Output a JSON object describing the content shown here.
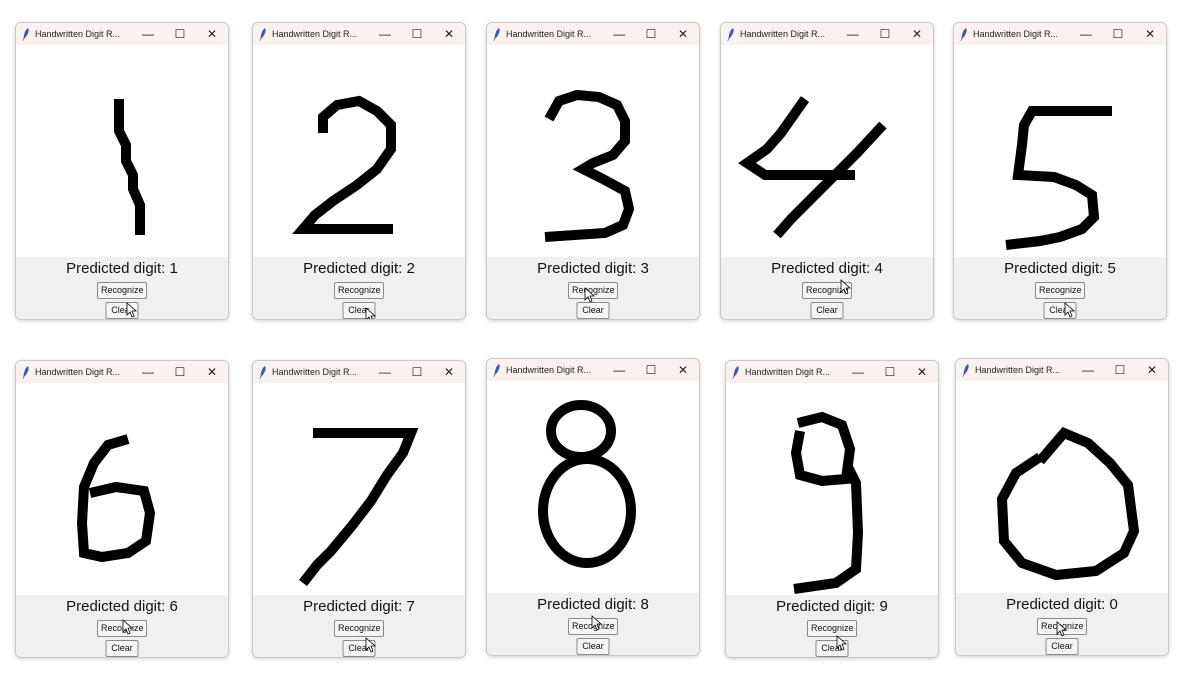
{
  "windows": [
    {
      "title": "Handwritten Digit R...",
      "prediction": "Predicted digit: 1",
      "recognize_label": "Recognize",
      "clear_label": "Clear",
      "minimize_label": "—",
      "maximize_label": "☐",
      "close_label": "✕",
      "digit": "1",
      "cursor_on": "clear"
    },
    {
      "title": "Handwritten Digit R...",
      "prediction": "Predicted digit: 2",
      "recognize_label": "Recognize",
      "clear_label": "Clear",
      "minimize_label": "—",
      "maximize_label": "☐",
      "close_label": "✕",
      "digit": "2",
      "cursor_on": "clear"
    },
    {
      "title": "Handwritten Digit R...",
      "prediction": "Predicted digit: 3",
      "recognize_label": "Recognize",
      "clear_label": "Clear",
      "minimize_label": "—",
      "maximize_label": "☐",
      "close_label": "✕",
      "digit": "3",
      "cursor_on": "recognize"
    },
    {
      "title": "Handwritten Digit R...",
      "prediction": "Predicted digit: 4",
      "recognize_label": "Recognize",
      "clear_label": "Clear",
      "minimize_label": "—",
      "maximize_label": "☐",
      "close_label": "✕",
      "digit": "4",
      "cursor_on": "recognize"
    },
    {
      "title": "Handwritten Digit R...",
      "prediction": "Predicted digit: 5",
      "recognize_label": "Recognize",
      "clear_label": "Clear",
      "minimize_label": "—",
      "maximize_label": "☐",
      "close_label": "✕",
      "digit": "5",
      "cursor_on": "clear"
    },
    {
      "title": "Handwritten Digit R...",
      "prediction": "Predicted digit: 6",
      "recognize_label": "Recognize",
      "clear_label": "Clear",
      "minimize_label": "—",
      "maximize_label": "☐",
      "close_label": "✕",
      "digit": "6",
      "cursor_on": "recognize"
    },
    {
      "title": "Handwritten Digit R...",
      "prediction": "Predicted digit: 7",
      "recognize_label": "Recognize",
      "clear_label": "Clear",
      "minimize_label": "—",
      "maximize_label": "☐",
      "close_label": "✕",
      "digit": "7",
      "cursor_on": "clear"
    },
    {
      "title": "Handwritten Digit R...",
      "prediction": "Predicted digit: 8",
      "recognize_label": "Recognize",
      "clear_label": "Clear",
      "minimize_label": "—",
      "maximize_label": "☐",
      "close_label": "✕",
      "digit": "8",
      "cursor_on": "recognize"
    },
    {
      "title": "Handwritten Digit R...",
      "prediction": "Predicted digit: 9",
      "recognize_label": "Recognize",
      "clear_label": "Clear",
      "minimize_label": "—",
      "maximize_label": "☐",
      "close_label": "✕",
      "digit": "9",
      "cursor_on": "clear"
    },
    {
      "title": "Handwritten Digit R...",
      "prediction": "Predicted digit: 0",
      "recognize_label": "Recognize",
      "clear_label": "Clear",
      "minimize_label": "—",
      "maximize_label": "☐",
      "close_label": "✕",
      "digit": "0",
      "cursor_on": "recognize"
    }
  ],
  "colors": {
    "stroke": "#000000",
    "titlebar": "#fbf2f0",
    "panel": "#f0f0f0",
    "feather": "#3a5bb0"
  }
}
